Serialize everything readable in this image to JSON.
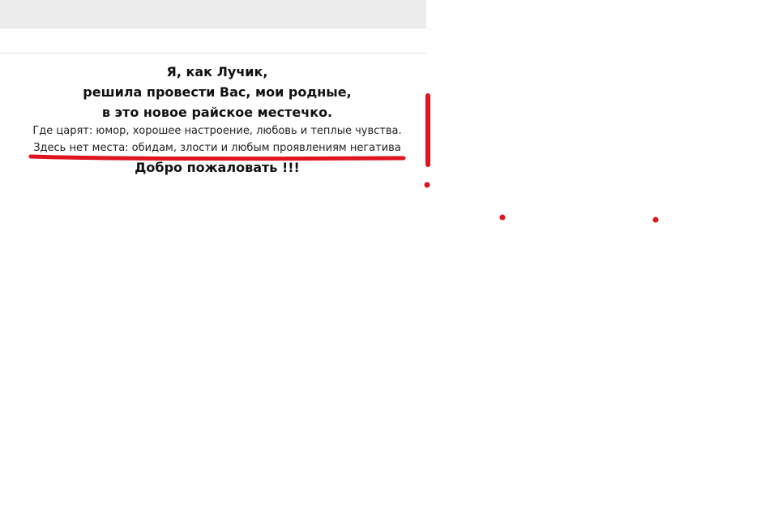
{
  "post": {
    "line1": "Я, как Лучик,",
    "line2": "решила провести Вас, мои родные,",
    "line3": "в это новое райское местечко.",
    "line4": "Где царят: юмор, хорошее настроение, любовь и теплые чувства.",
    "line5": "Здесь нет места: обидам, злости и любым проявлениям негатива",
    "line6": "Добро пожаловать !!!"
  },
  "colors": {
    "annotation": "#e0141e",
    "top_bar": "#ececec",
    "text": "#111111"
  }
}
